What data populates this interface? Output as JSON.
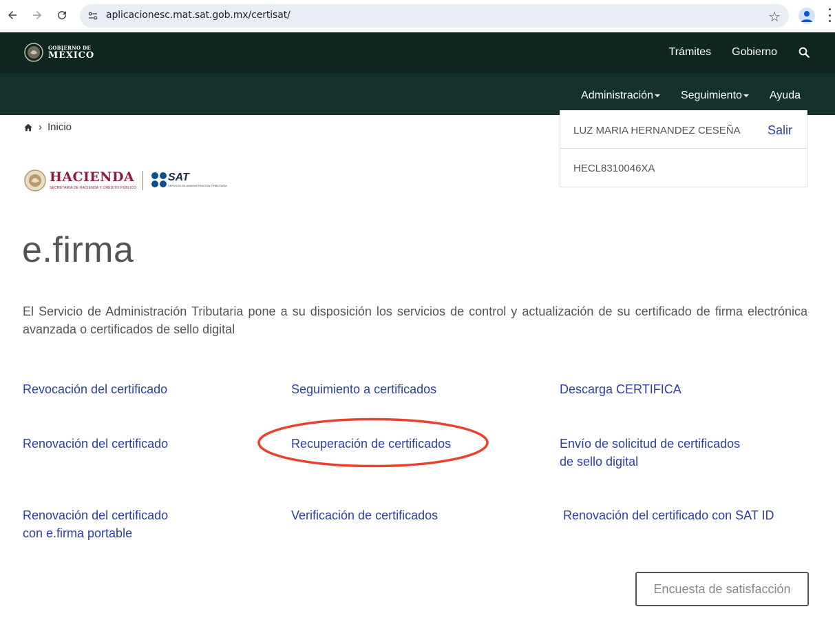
{
  "browser": {
    "url": "aplicacionesc.mat.sat.gob.mx/certisat/"
  },
  "gob_header": {
    "logo_line1": "GOBIERNO DE",
    "logo_line2": "MÉXICO",
    "links": [
      "Trámites",
      "Gobierno"
    ]
  },
  "sub_nav": {
    "items": [
      "Administración",
      "Seguimiento",
      "Ayuda"
    ]
  },
  "breadcrumb": {
    "label": "Inicio"
  },
  "user": {
    "name": "LUZ MARIA HERNANDEZ CESEÑA",
    "logout": "Salir",
    "rfc": "HECL8310046XA"
  },
  "logos": {
    "hacienda_title": "HACIENDA",
    "hacienda_subtitle": "SECRETARÍA DE HACIENDA Y CRÉDITO PÚBLICO",
    "sat_title": "SAT",
    "sat_subtitle": "SERVICIO DE ADMINISTRACIÓN TRIBUTARIA"
  },
  "page": {
    "title": "e.firma",
    "intro": "El Servicio de Administración Tributaria pone a su disposición los servicios de control y actualización de su certificado de firma electrónica avanzada o certificados de sello digital"
  },
  "links": {
    "revocacion": "Revocación del certificado",
    "seguimiento": "Seguimiento a certificados",
    "descarga": "Descarga CERTIFICA",
    "renovacion": "Renovación del certificado",
    "recuperacion": "Recuperación de certificados",
    "envio_l1": "Envío de solicitud de certificados",
    "envio_l2": "de sello digital",
    "renovacion_portable_l1": "Renovación del certificado",
    "renovacion_portable_l2": "con e.firma portable",
    "verificacion": "Verificación de certificados",
    "renovacion_satid": "Renovación del certificado con SAT ID"
  },
  "survey_button": "Encuesta de satisfacción",
  "colors": {
    "header_dark": "#0f2621",
    "header_sub": "#13322b",
    "link_blue": "#2a3fa3",
    "annotation_red": "#e8412c"
  }
}
